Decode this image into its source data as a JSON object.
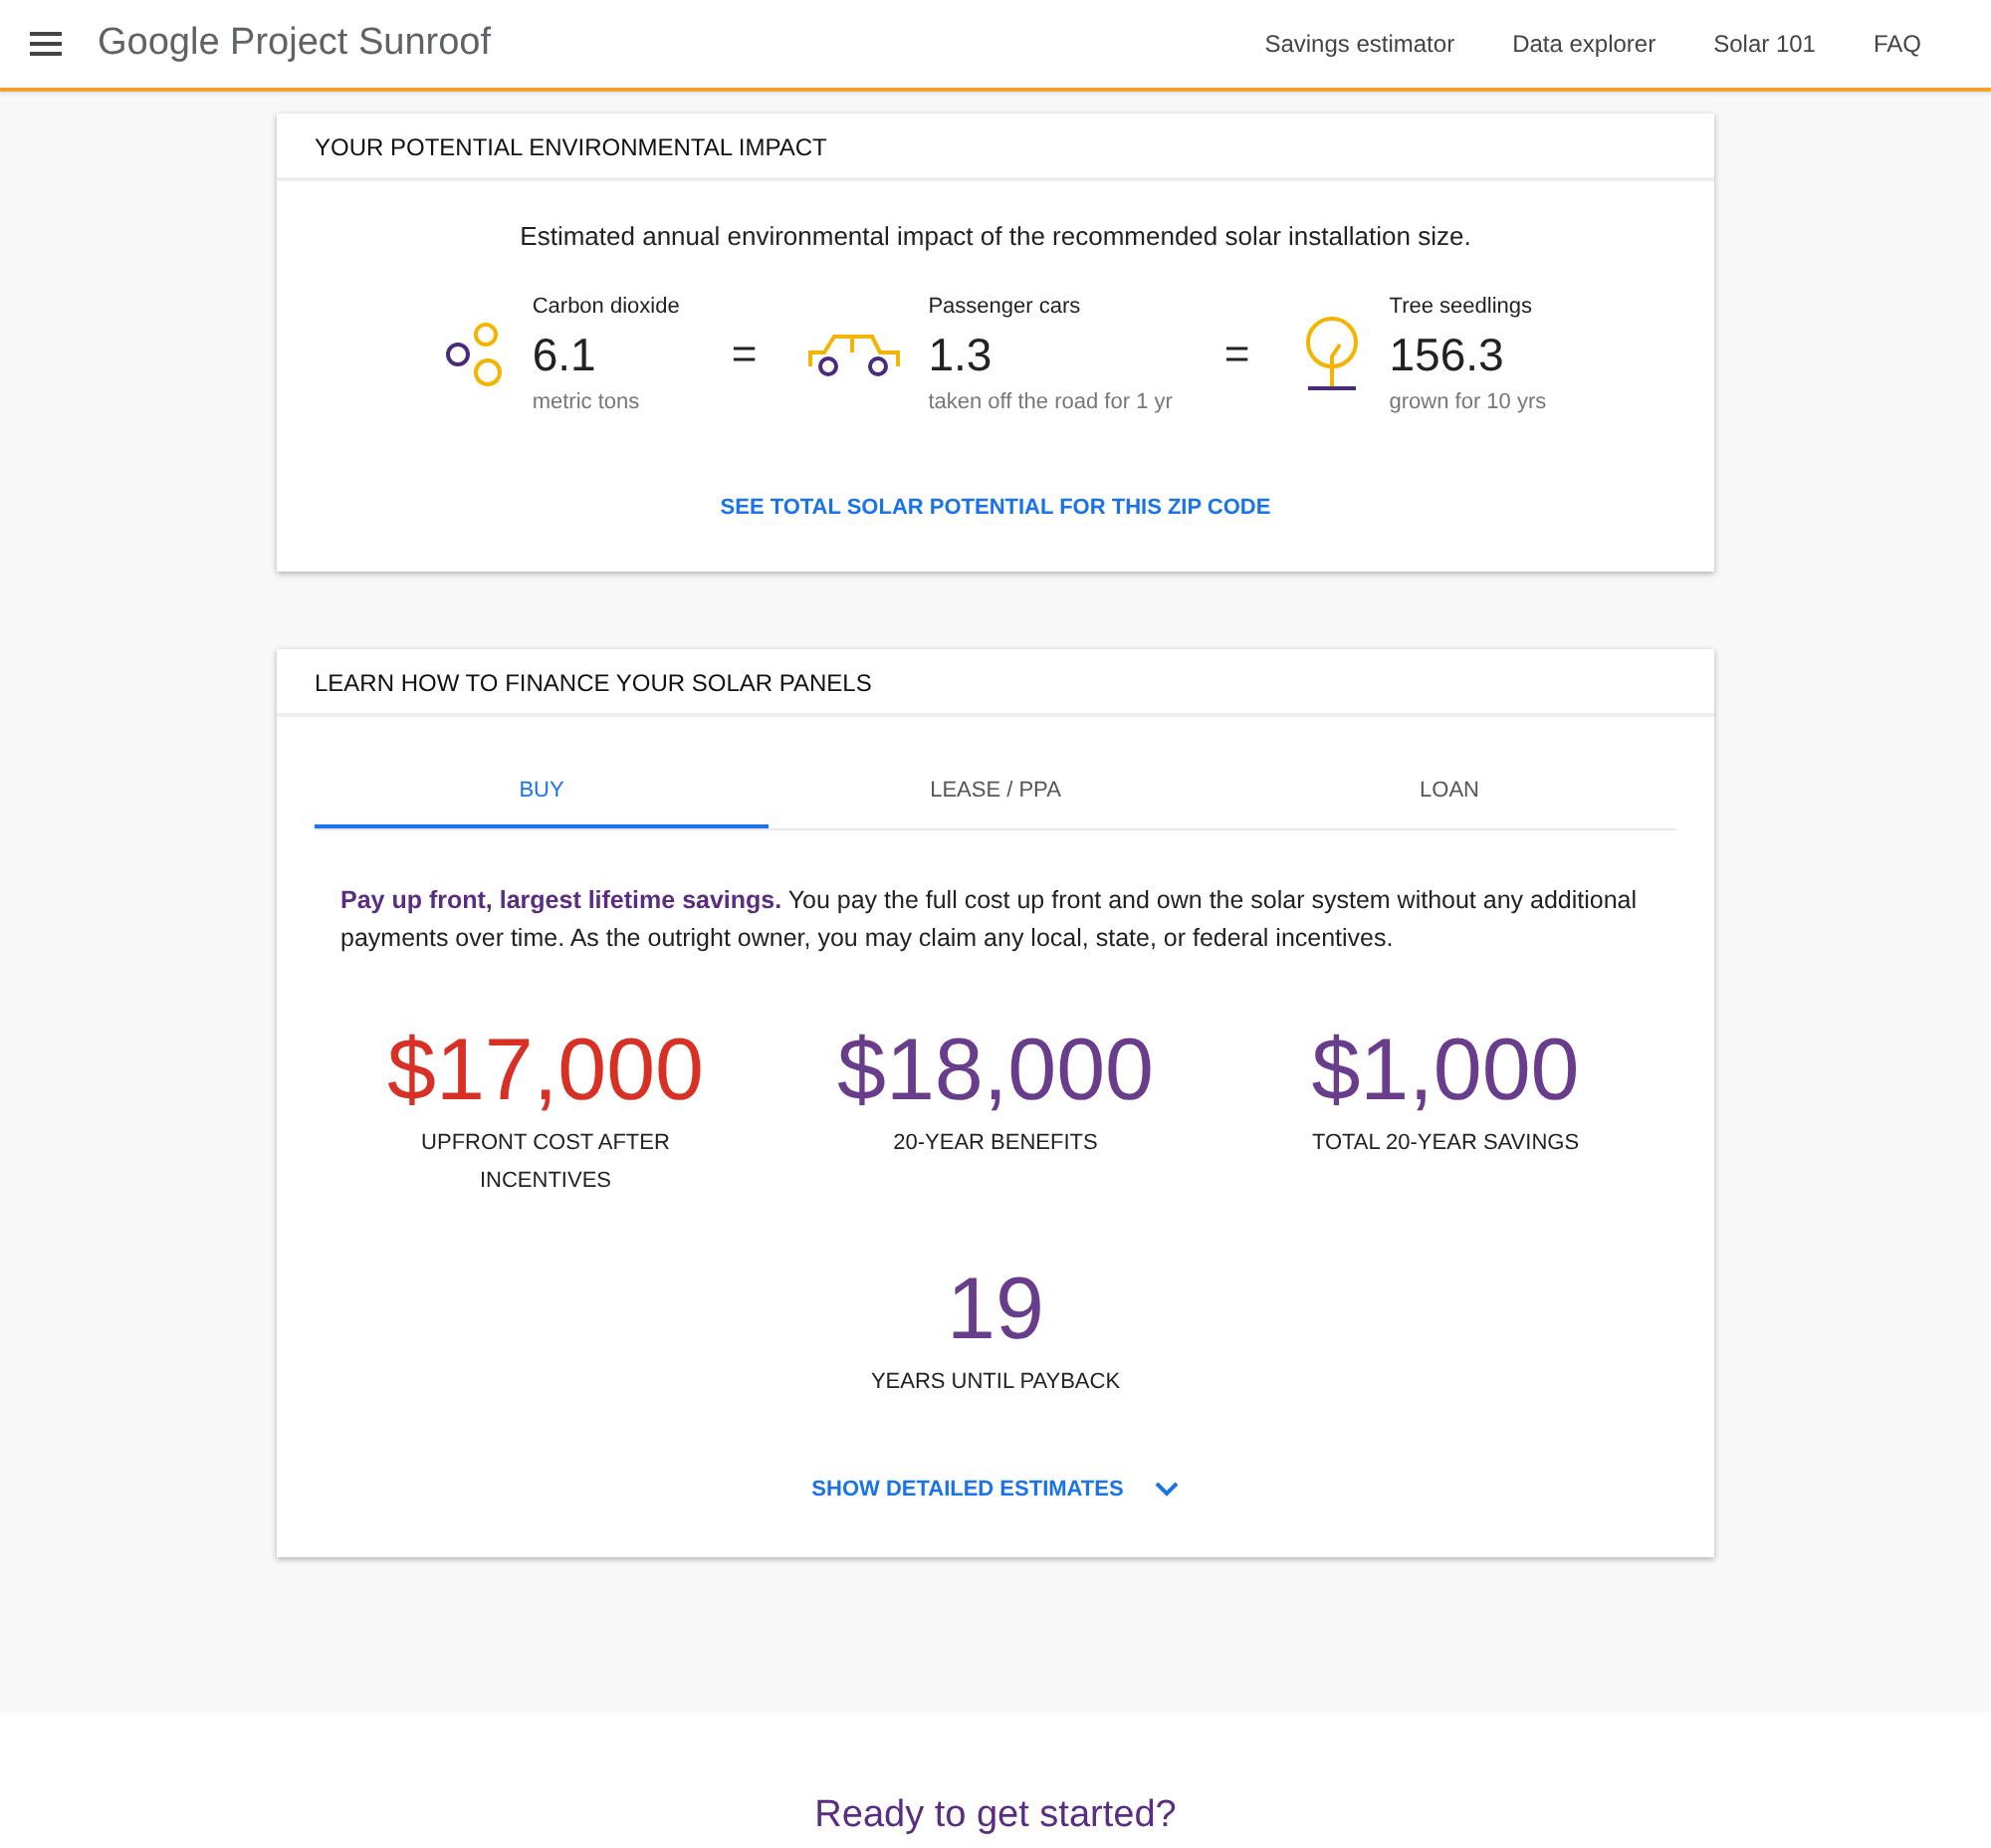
{
  "header": {
    "logo": "Google Project Sunroof",
    "nav": [
      {
        "label": "Savings estimator"
      },
      {
        "label": "Data explorer"
      },
      {
        "label": "Solar 101"
      },
      {
        "label": "FAQ"
      }
    ]
  },
  "impact": {
    "title": "YOUR POTENTIAL ENVIRONMENTAL IMPACT",
    "intro": "Estimated annual environmental impact of the recommended solar installation size.",
    "separator": "=",
    "items": [
      {
        "kind": "bubbles",
        "label": "Carbon dioxide",
        "value": "6.1",
        "unit": "metric tons"
      },
      {
        "kind": "car",
        "label": "Passenger cars",
        "value": "1.3",
        "unit": "taken off the road for 1 yr"
      },
      {
        "kind": "tree",
        "label": "Tree seedlings",
        "value": "156.3",
        "unit": "grown for 10 yrs"
      }
    ],
    "link": "SEE TOTAL SOLAR POTENTIAL FOR THIS ZIP CODE"
  },
  "finance": {
    "title": "LEARN HOW TO FINANCE YOUR SOLAR PANELS",
    "tabs": [
      {
        "label": "BUY",
        "selected": true
      },
      {
        "label": "LEASE / PPA",
        "selected": false
      },
      {
        "label": "LOAN",
        "selected": false
      }
    ],
    "description": "**Pay up front, largest lifetime savings.** You pay the full cost up front and own the solar system without any additional payments over time. As the outright owner, you may claim any local, state, or federal incentives.",
    "stats": [
      {
        "value": "$17,000",
        "label": "UPFRONT COST AFTER INCENTIVES",
        "color": "#d93025"
      },
      {
        "value": "$18,000",
        "label": "20-YEAR BENEFITS",
        "color": "#6a3d8c"
      },
      {
        "value": "$1,000",
        "label": "TOTAL 20-YEAR SAVINGS",
        "color": "#6a3d8c"
      },
      {
        "value": "19",
        "label": "YEARS UNTIL PAYBACK",
        "color": "#6a3d8c"
      }
    ],
    "details_link": "SHOW DETAILED ESTIMATES"
  },
  "cta": {
    "title": "Ready to get started?"
  }
}
